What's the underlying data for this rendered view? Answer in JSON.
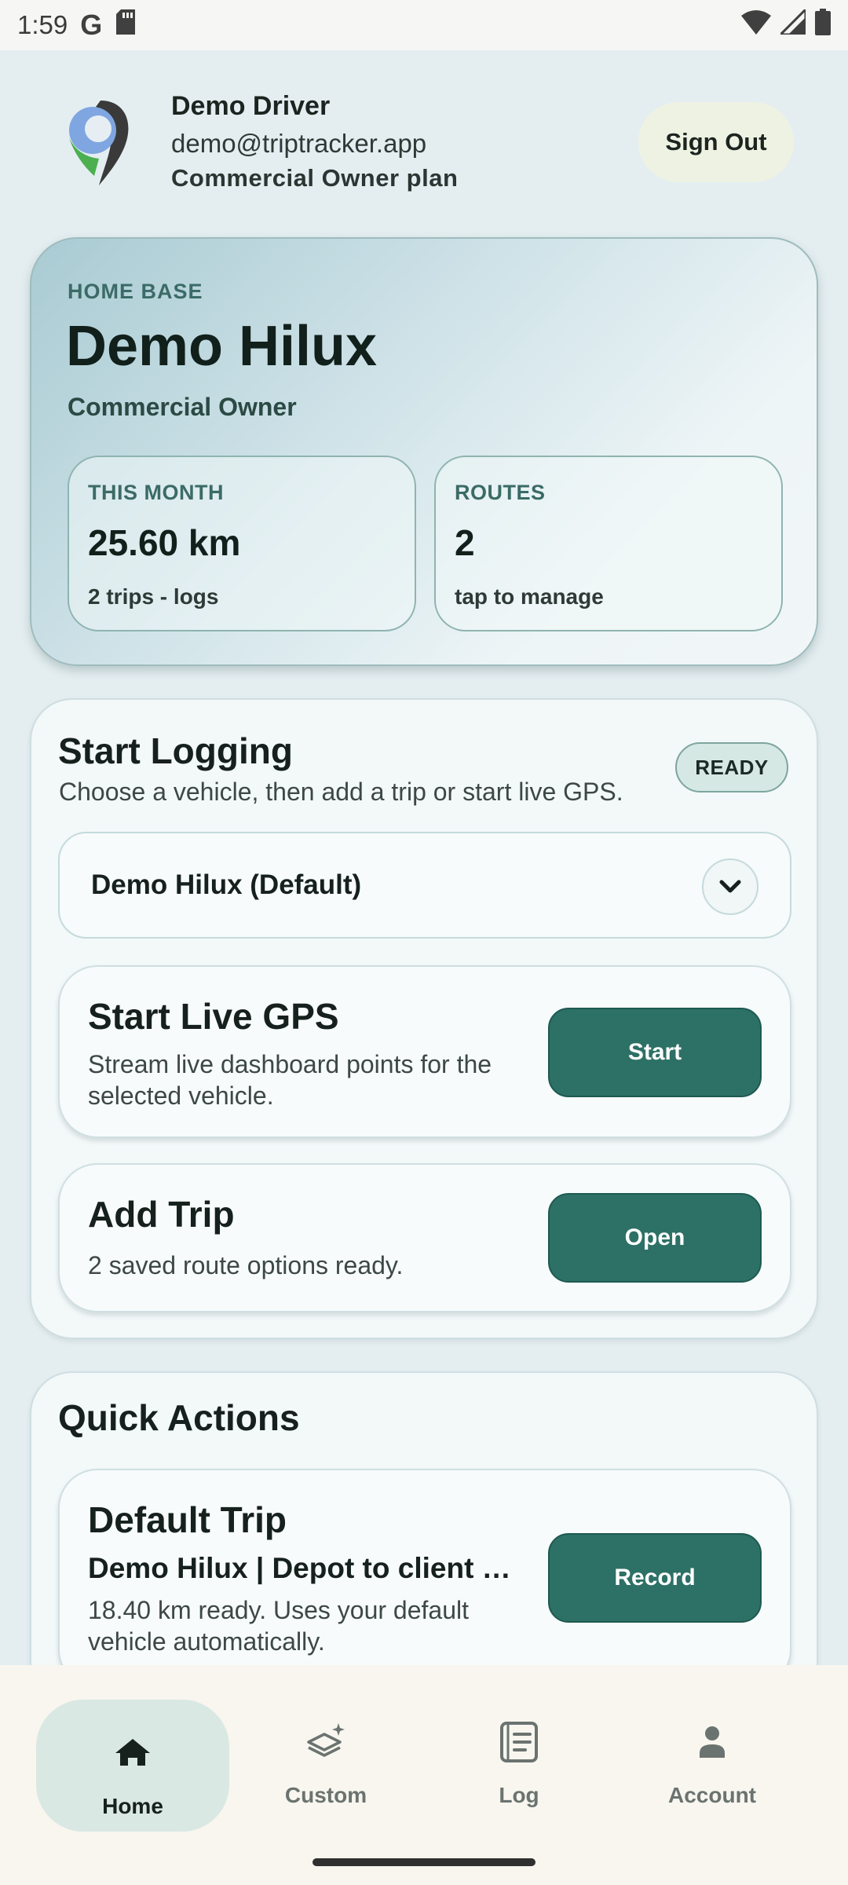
{
  "status_bar": {
    "time": "1:59",
    "google_glyph": "G"
  },
  "header": {
    "user_name": "Demo Driver",
    "email": "demo@triptracker.app",
    "plan": "Commercial Owner plan",
    "sign_out_label": "Sign Out"
  },
  "home_base": {
    "eyebrow": "HOME BASE",
    "vehicle": "Demo Hilux",
    "role": "Commercial Owner",
    "stats": [
      {
        "label": "THIS MONTH",
        "value": "25.60 km",
        "note": "2 trips - logs"
      },
      {
        "label": "ROUTES",
        "value": "2",
        "note": "tap to manage"
      }
    ]
  },
  "start_logging": {
    "title": "Start Logging",
    "description": "Choose a vehicle, then add a trip or start live GPS.",
    "badge": "READY",
    "selected_vehicle": "Demo Hilux (Default)",
    "live_gps": {
      "title": "Start Live GPS",
      "description": "Stream live dashboard points for the selected vehicle.",
      "button": "Start"
    },
    "add_trip": {
      "title": "Add Trip",
      "description": "2 saved route options ready.",
      "button": "Open"
    }
  },
  "quick_actions": {
    "title": "Quick Actions",
    "default_trip": {
      "title": "Default Trip",
      "subtitle": "Demo Hilux | Depot to client l…",
      "description": "18.40 km ready. Uses your default vehicle automatically.",
      "button": "Record"
    }
  },
  "bottom_nav": {
    "items": [
      {
        "label": "Home",
        "icon": "home-icon",
        "active": true
      },
      {
        "label": "Custom",
        "icon": "layers-sparkle-icon",
        "active": false
      },
      {
        "label": "Log",
        "icon": "document-icon",
        "active": false
      },
      {
        "label": "Account",
        "icon": "person-icon",
        "active": false
      }
    ]
  },
  "colors": {
    "accent": "#2d7066",
    "background": "#e4eef1",
    "nav_active_pill": "#d9e8e3"
  }
}
